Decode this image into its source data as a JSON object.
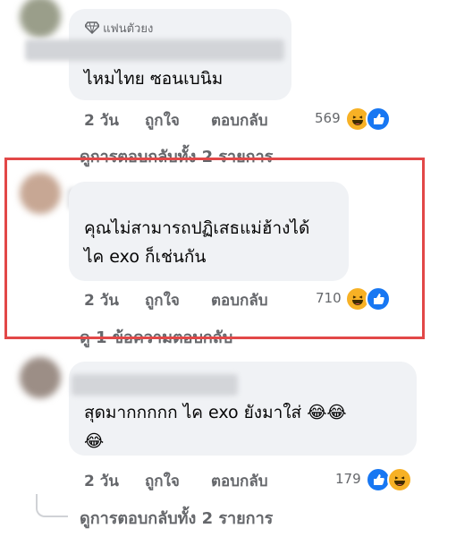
{
  "comments": [
    {
      "badge": "แฟนตัวยง",
      "text_lines": [
        "ไหมไทย ซอนเบนิม"
      ],
      "time": "2 วัน",
      "like_label": "ถูกใจ",
      "reply_label": "ตอบกลับ",
      "reaction_count": "569",
      "view_replies": "ดูการตอบกลับทั้ง 2 รายการ"
    },
    {
      "text_lines": [
        "คุณไม่สามารถปฏิเสธแม่ฮ้างได้",
        "ไค exo ก็เช่นกัน"
      ],
      "time": "2 วัน",
      "like_label": "ถูกใจ",
      "reply_label": "ตอบกลับ",
      "reaction_count": "710",
      "view_replies": "ดู 1 ข้อความตอบกลับ"
    },
    {
      "text_lines": [
        "สุดมากกกกก ไค exo ยังมาใส่ 😂😂",
        "😂"
      ],
      "time": "2 วัน",
      "like_label": "ถูกใจ",
      "reply_label": "ตอบกลับ",
      "reaction_count": "179",
      "view_replies": "ดูการตอบกลับทั้ง 2 รายการ"
    }
  ],
  "colors": {
    "bubble": "#f0f2f5",
    "secondary_text": "#65676b",
    "like_blue": "#1877f2",
    "haha_yellow": "#f7b125",
    "highlight_red": "#e24848"
  },
  "icons": [
    "diamond-icon",
    "haha-reaction-icon",
    "like-reaction-icon"
  ]
}
